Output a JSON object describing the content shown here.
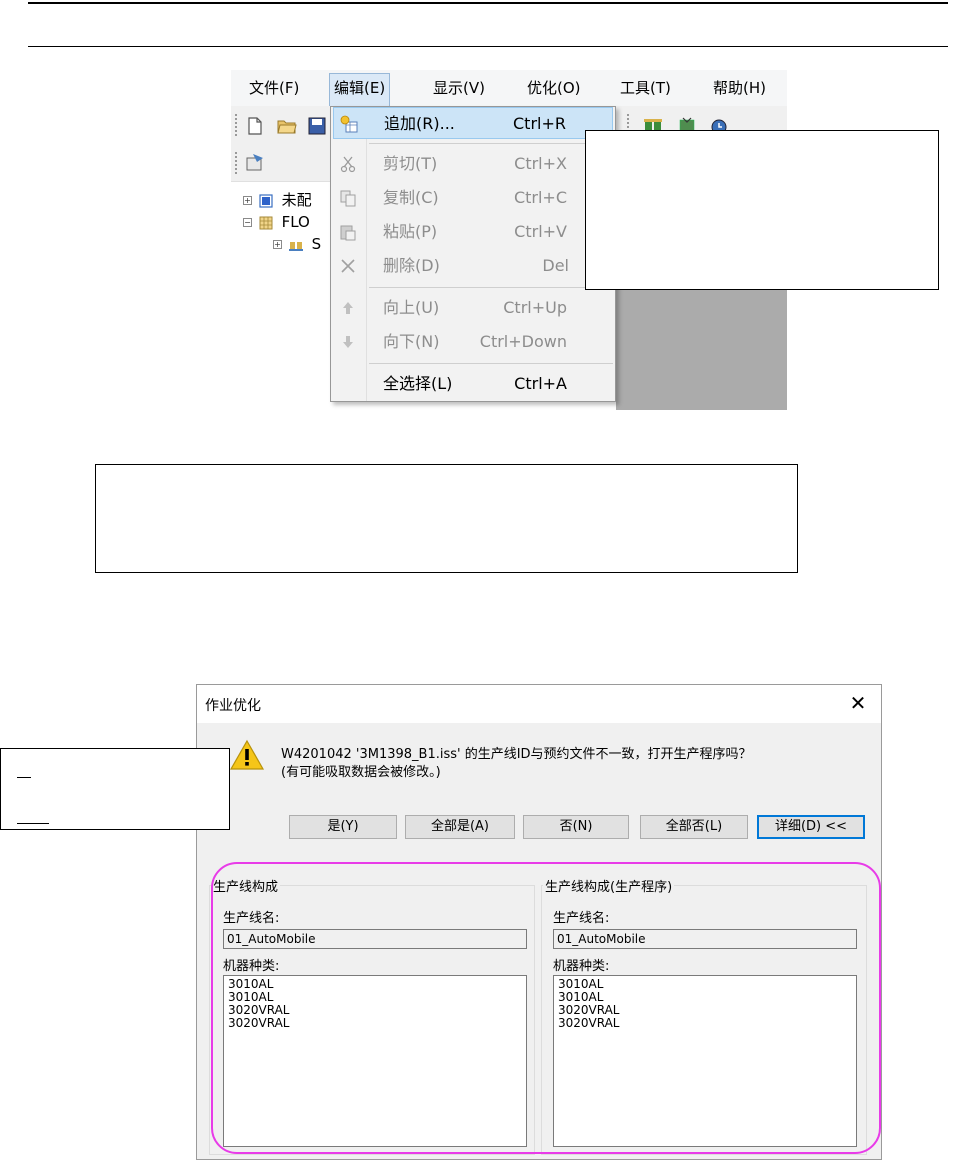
{
  "menubar": {
    "items": [
      {
        "label": "文件(F)"
      },
      {
        "label": "编辑(E)"
      },
      {
        "label": "显示(V)"
      },
      {
        "label": "优化(O)"
      },
      {
        "label": "工具(T)"
      },
      {
        "label": "帮助(H)"
      }
    ]
  },
  "edit_menu": {
    "items": [
      {
        "label": "追加(R)...",
        "shortcut": "Ctrl+R",
        "icon": "add-icon"
      },
      {
        "label": "剪切(T)",
        "shortcut": "Ctrl+X",
        "icon": "scissors-icon"
      },
      {
        "label": "复制(C)",
        "shortcut": "Ctrl+C",
        "icon": "copy-icon"
      },
      {
        "label": "粘贴(P)",
        "shortcut": "Ctrl+V",
        "icon": "paste-icon"
      },
      {
        "label": "删除(D)",
        "shortcut": "Del",
        "icon": "delete-icon"
      },
      {
        "label": "向上(U)",
        "shortcut": "Ctrl+Up",
        "icon": "arrow-up-icon"
      },
      {
        "label": "向下(N)",
        "shortcut": "Ctrl+Down",
        "icon": "arrow-down-icon"
      },
      {
        "label": "全选择(L)",
        "shortcut": "Ctrl+A"
      }
    ]
  },
  "tree": {
    "items": [
      {
        "label": "未配"
      },
      {
        "label": "FLO"
      },
      {
        "label": "S"
      }
    ]
  },
  "dialog": {
    "title": "作业优化",
    "message_line1": "W4201042 '3M1398_B1.iss' 的生产线ID与预约文件不一致，打开生产程序吗？",
    "message_line2": "(有可能吸取数据会被修改。)",
    "buttons": {
      "yes": "是(Y)",
      "yes_all": "全部是(A)",
      "no": "否(N)",
      "no_all": "全部否(L)",
      "details": "详细(D) <<"
    },
    "left_group": {
      "title": "生产线构成",
      "line_name_label": "生产线名:",
      "line_name_value": "01_AutoMobile",
      "machine_type_label": "机器种类:",
      "machines": [
        "3010AL",
        "3010AL",
        "3020VRAL",
        "3020VRAL"
      ]
    },
    "right_group": {
      "title": "生产线构成(生产程序)",
      "line_name_label": "生产线名:",
      "line_name_value": "01_AutoMobile",
      "machine_type_label": "机器种类:",
      "machines": [
        "3010AL",
        "3010AL",
        "3020VRAL",
        "3020VRAL"
      ]
    }
  },
  "colors": {
    "menu_highlight": "#cce4f7",
    "highlight_outline": "#e83be8",
    "default_button_border": "#0078d7"
  }
}
